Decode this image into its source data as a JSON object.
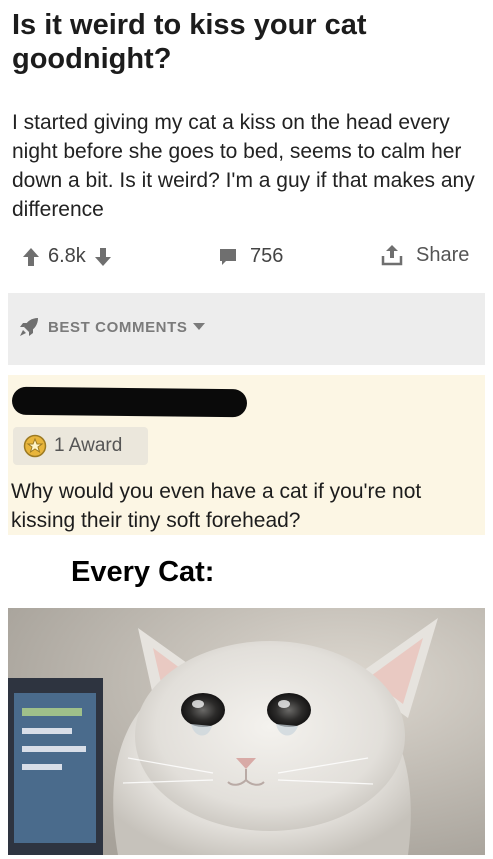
{
  "post": {
    "title": "Is it weird to kiss your cat goodnight?",
    "body": "I started giving my cat a kiss on the head every night before she goes to bed, seems to calm her down a bit. Is it weird? I'm a guy if that makes any difference",
    "upvotes": "6.8k",
    "comment_count": "756",
    "share_label": "Share"
  },
  "comments_header": {
    "sort_label": "BEST COMMENTS"
  },
  "top_comment": {
    "award_label": "1 Award",
    "text": "Why would you even have a cat if you're not kissing their tiny soft forehead?"
  },
  "meme": {
    "caption": "Every Cat:"
  },
  "colors": {
    "comment_background": "#fcf6e4",
    "sort_band_background": "#ededed",
    "icon_gray": "#7c7c7c"
  }
}
